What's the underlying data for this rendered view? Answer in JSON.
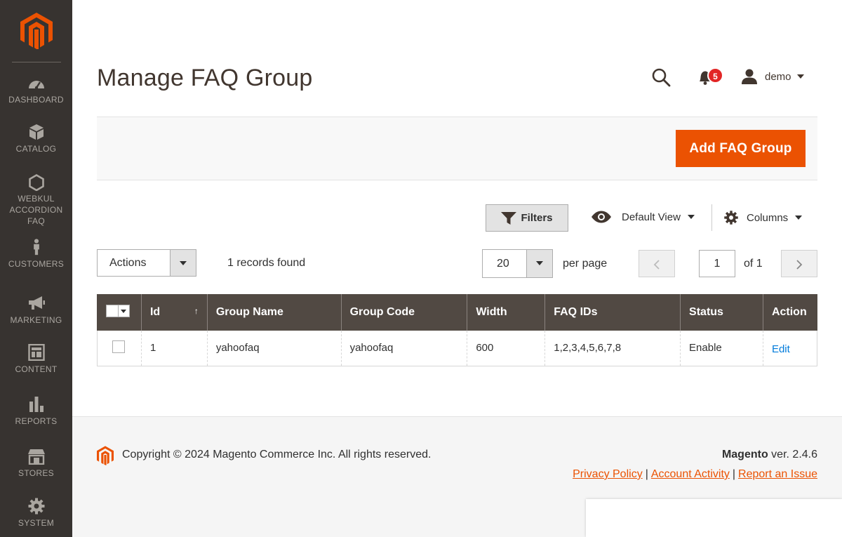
{
  "sidebar": {
    "items": [
      {
        "label": "DASHBOARD",
        "icon": "dashboard-icon"
      },
      {
        "label": "CATALOG",
        "icon": "catalog-icon"
      },
      {
        "label_lines": [
          "WEBKUL",
          "ACCORDION",
          "FAQ"
        ],
        "icon": "hexagon-icon"
      },
      {
        "label": "CUSTOMERS",
        "icon": "customers-icon"
      },
      {
        "label": "MARKETING",
        "icon": "megaphone-icon"
      },
      {
        "label": "CONTENT",
        "icon": "content-icon"
      },
      {
        "label": "REPORTS",
        "icon": "reports-icon"
      },
      {
        "label": "STORES",
        "icon": "stores-icon"
      },
      {
        "label": "SYSTEM",
        "icon": "gear-icon"
      }
    ]
  },
  "header": {
    "title": "Manage FAQ Group",
    "notifications_count": "5",
    "user_name": "demo"
  },
  "toolbar": {
    "add_button": "Add FAQ Group"
  },
  "grid_controls": {
    "filters_label": "Filters",
    "view_label": "Default View",
    "columns_label": "Columns",
    "actions_label": "Actions",
    "records_found": "1 records found",
    "per_page_value": "20",
    "per_page_label": "per page",
    "page_value": "1",
    "page_of": "of 1"
  },
  "table": {
    "columns": [
      "Id",
      "Group Name",
      "Group Code",
      "Width",
      "FAQ IDs",
      "Status",
      "Action"
    ],
    "sort_indicator": "↑",
    "rows": [
      {
        "id": "1",
        "group_name": "yahoofaq",
        "group_code": "yahoofaq",
        "width": "600",
        "faq_ids": "1,2,3,4,5,6,7,8",
        "status": "Enable",
        "action": "Edit"
      }
    ]
  },
  "footer": {
    "copyright": "Copyright © 2024 Magento Commerce Inc. All rights reserved.",
    "brand": "Magento",
    "version": " ver. 2.4.6",
    "links": [
      "Privacy Policy",
      "Account Activity",
      "Report an Issue"
    ],
    "separator": "|"
  },
  "colors": {
    "sidebar_bg": "#373330",
    "accent": "#eb5202",
    "table_header_bg": "#514943",
    "link": "#007bdb"
  }
}
